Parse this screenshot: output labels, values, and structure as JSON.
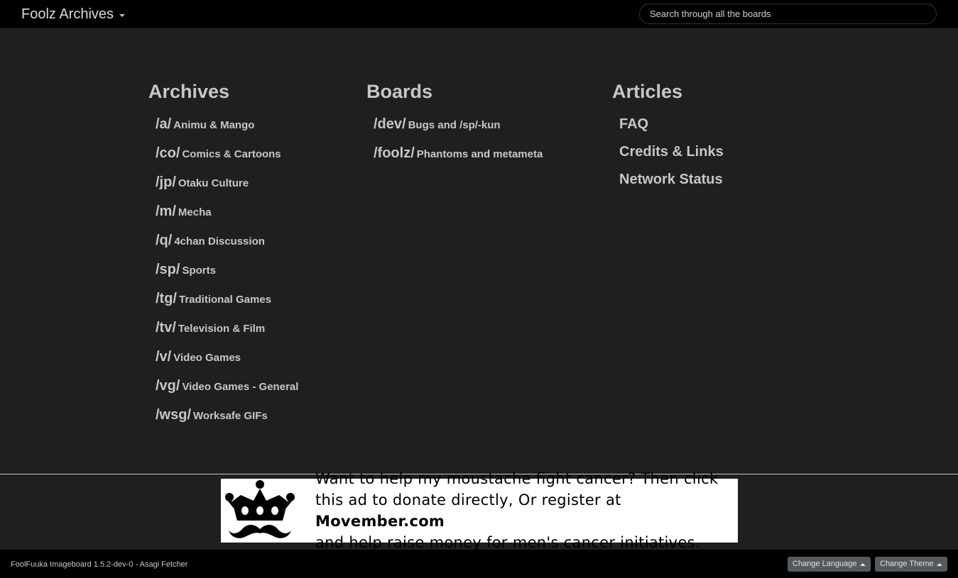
{
  "header": {
    "brand": "Foolz Archives",
    "search_placeholder": "Search through all the boards"
  },
  "archives": {
    "title": "Archives",
    "items": [
      {
        "short": "/a/",
        "name": "Animu & Mango"
      },
      {
        "short": "/co/",
        "name": "Comics & Cartoons"
      },
      {
        "short": "/jp/",
        "name": "Otaku Culture"
      },
      {
        "short": "/m/",
        "name": "Mecha"
      },
      {
        "short": "/q/",
        "name": "4chan Discussion"
      },
      {
        "short": "/sp/",
        "name": "Sports"
      },
      {
        "short": "/tg/",
        "name": "Traditional Games"
      },
      {
        "short": "/tv/",
        "name": "Television & Film"
      },
      {
        "short": "/v/",
        "name": "Video Games"
      },
      {
        "short": "/vg/",
        "name": "Video Games - General"
      },
      {
        "short": "/wsg/",
        "name": "Worksafe GIFs"
      }
    ]
  },
  "boards": {
    "title": "Boards",
    "items": [
      {
        "short": "/dev/",
        "name": "Bugs and /sp/-kun"
      },
      {
        "short": "/foolz/",
        "name": "Phantoms and metameta"
      }
    ]
  },
  "articles": {
    "title": "Articles",
    "items": [
      "FAQ",
      "Credits & Links",
      "Network Status"
    ]
  },
  "ad": {
    "line1": "Want to help my moustache fight cancer? Then click",
    "line2_pre": "this ad to donate directly, Or register at ",
    "line2_bold": "Movember.com",
    "line3": "and help raise money for men's cancer initiatives.",
    "icon": "crown-moustache-icon"
  },
  "footer": {
    "version": "FoolFuuka Imageboard 1.5.2-dev-0 - Asagi Fetcher",
    "change_language": "Change Language",
    "change_theme": "Change Theme"
  }
}
